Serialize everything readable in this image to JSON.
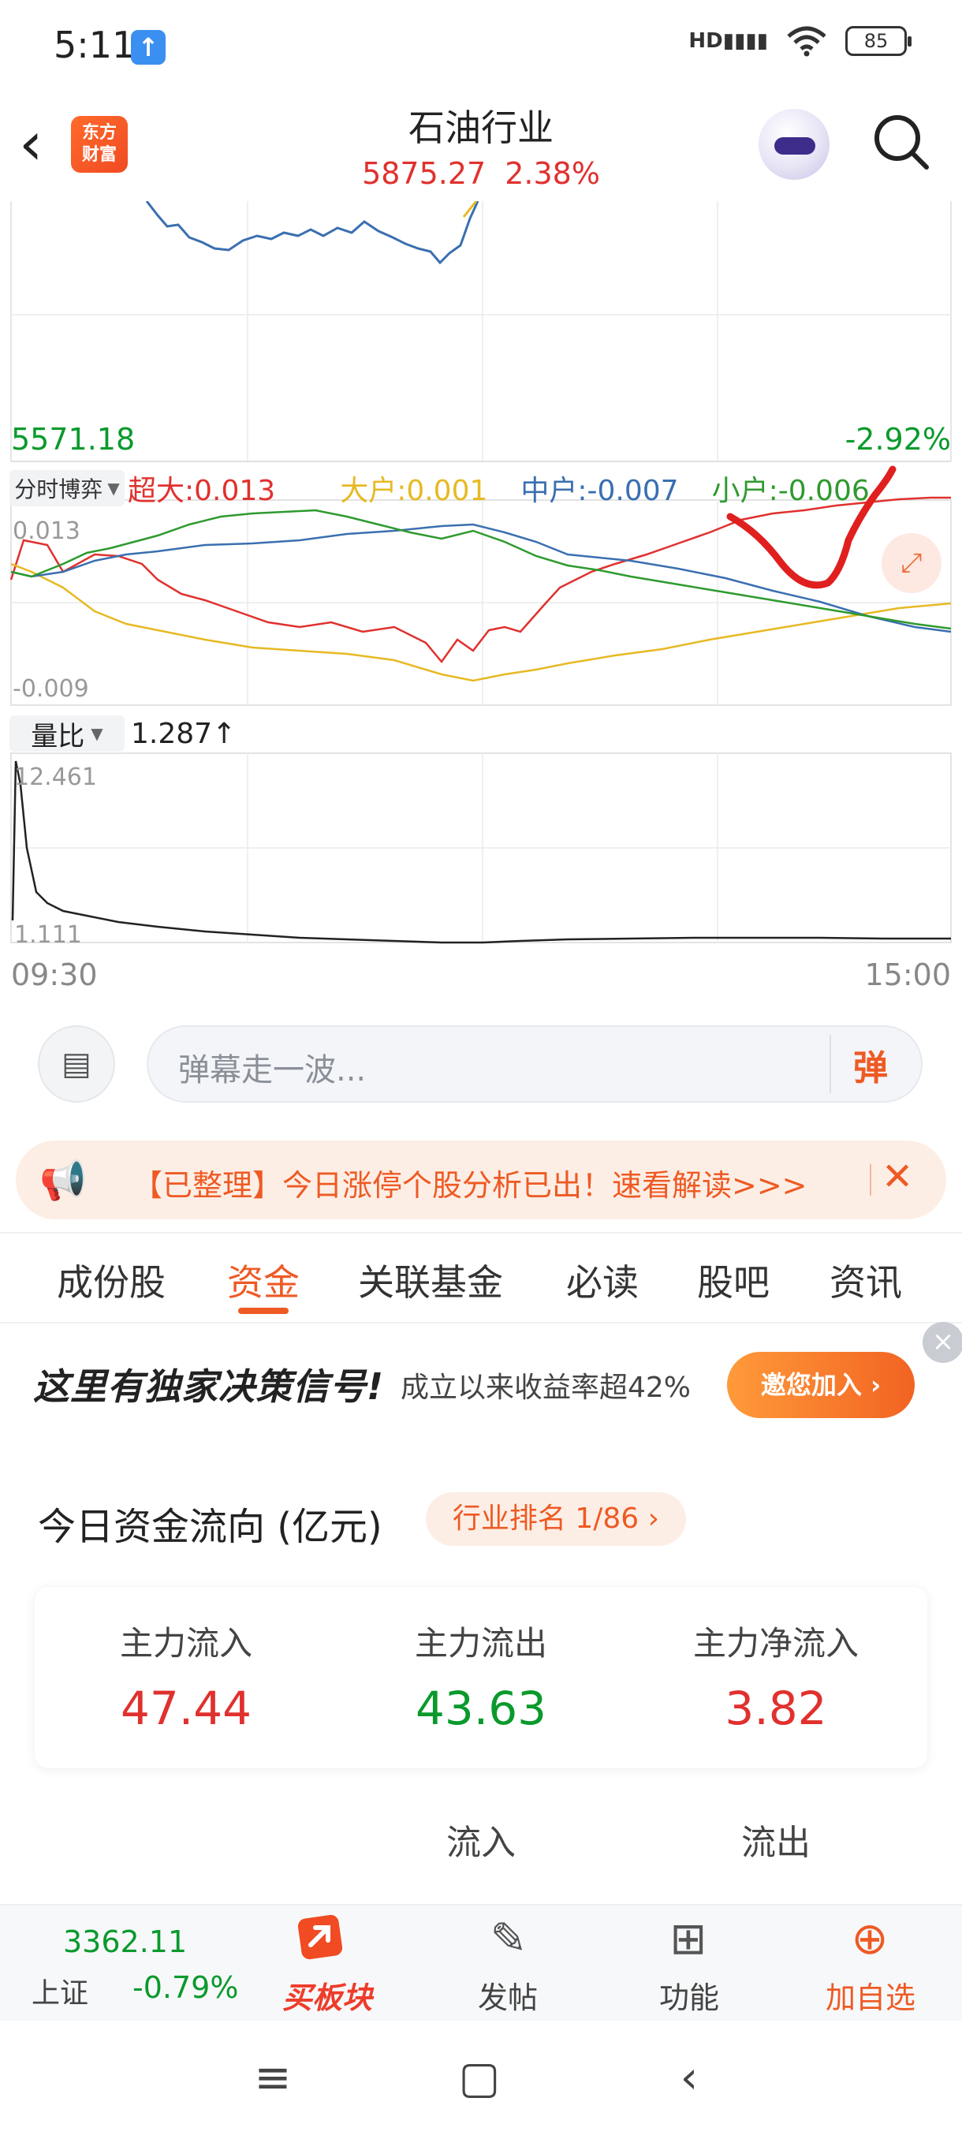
{
  "status": {
    "time": "5:11",
    "signal_label": "HD",
    "battery": "85"
  },
  "header": {
    "brand_line1": "东方",
    "brand_line2": "财富",
    "title": "石油行业",
    "price": "5875.27",
    "change_pct": "2.38%"
  },
  "price_chart": {
    "low_price": "5571.18",
    "low_pct": "-2.92%"
  },
  "fund_chart": {
    "mode": "分时博弈",
    "legend": {
      "super": "超大:0.013",
      "big": "大户:0.001",
      "mid": "中户:-0.007",
      "small": "小户:-0.006"
    },
    "max_label": "0.013",
    "min_label": "-0.009",
    "colors": {
      "super": "#e0312e",
      "big": "#e7b923",
      "mid": "#3a6fb0",
      "small": "#2e9a2e"
    }
  },
  "volume_chart": {
    "mode": "量比",
    "value": "1.287",
    "arrow": "↑",
    "max_label": "12.461",
    "min_label": "1.111",
    "time_start": "09:30",
    "time_end": "15:00"
  },
  "danmu": {
    "placeholder": "弹幕走一波...",
    "send_label": "弹"
  },
  "notice": {
    "text": "【已整理】今日涨停个股分析已出！速看解读>>>"
  },
  "tabs": [
    {
      "label": "成份股"
    },
    {
      "label": "资金"
    },
    {
      "label": "关联基金"
    },
    {
      "label": "必读"
    },
    {
      "label": "股吧"
    },
    {
      "label": "资讯"
    }
  ],
  "active_tab": "资金",
  "ad": {
    "title": "这里有独家决策信号!",
    "subtitle": "成立以来收益率超42%",
    "button": "邀您加入 ›"
  },
  "capital_flow": {
    "title": "今日资金流向 (亿元)",
    "rank": "行业排名 1/86 ›",
    "items": [
      {
        "label": "主力流入",
        "value": "47.44"
      },
      {
        "label": "主力流出",
        "value": "43.63"
      },
      {
        "label": "主力净流入",
        "value": "3.82"
      }
    ],
    "sub_headers": [
      "流入",
      "流出"
    ]
  },
  "bottom_bar": {
    "index_value": "3362.11",
    "index_name": "上证",
    "index_change": "-0.79%",
    "buy_label": "买板块",
    "post_label": "发帖",
    "func_label": "功能",
    "add_label": "加自选"
  },
  "accent_color": "#ee5a24"
}
